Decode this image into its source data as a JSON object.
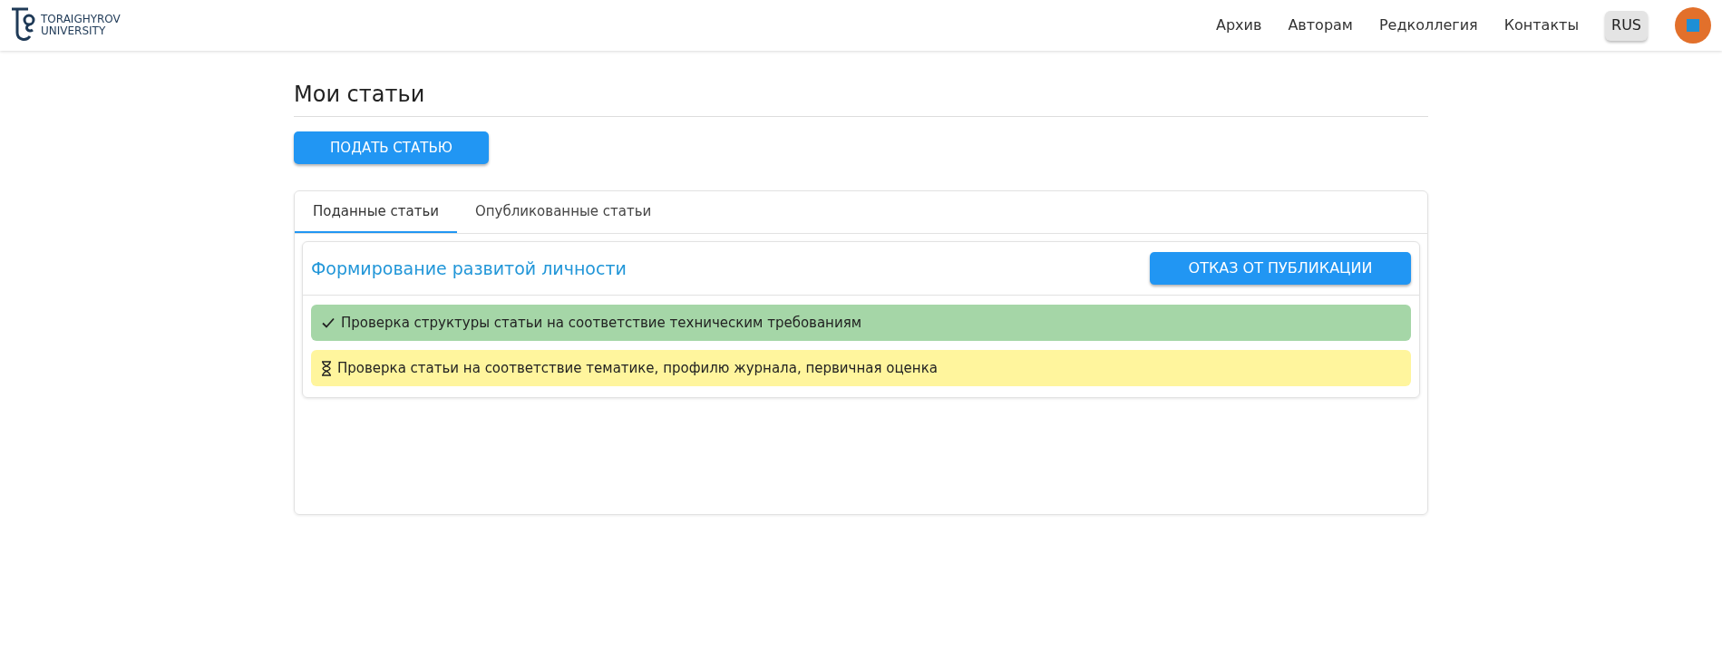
{
  "header": {
    "logo": {
      "line1": "TORAIGHYROV",
      "line2": "UNIVERSITY"
    },
    "nav": [
      "Архив",
      "Авторам",
      "Редколлегия",
      "Контакты"
    ],
    "language": "RUS"
  },
  "page": {
    "title": "Мои статьи",
    "submit_button": "ПОДАТЬ СТАТЬЮ",
    "tabs": [
      {
        "label": "Поданные статьи",
        "selected": true
      },
      {
        "label": "Опубликованные статьи",
        "selected": false
      }
    ],
    "articles": [
      {
        "title": "Формирование развитой личности",
        "withdraw_button": "ОТКАЗ ОТ ПУБЛИКАЦИИ",
        "stages": [
          {
            "kind": "done",
            "text": "Проверка структуры статьи на соответствие техническим требованиям"
          },
          {
            "kind": "pending",
            "text": "Проверка статьи на соответствие тематике, профилю журнала, первичная оценка"
          }
        ]
      }
    ]
  }
}
